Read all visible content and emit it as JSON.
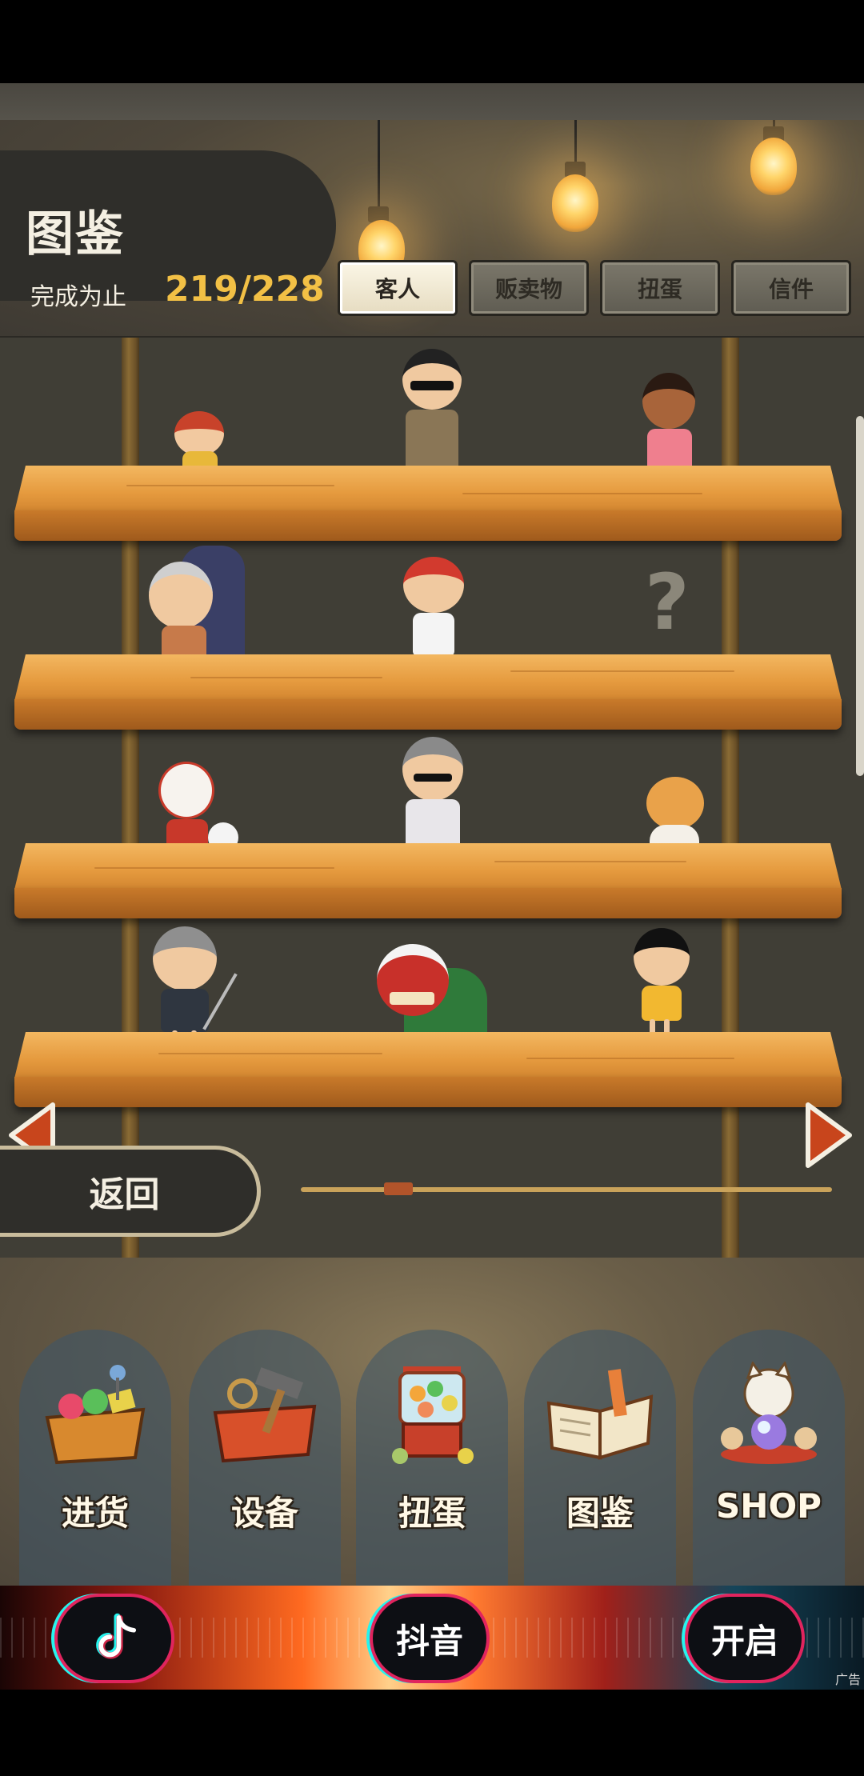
{
  "header": {
    "title": "图鉴",
    "progress_label": "完成为止",
    "progress_value": "219/228"
  },
  "tabs": [
    {
      "label": "客人",
      "active": true
    },
    {
      "label": "贩卖物",
      "active": false
    },
    {
      "label": "扭蛋",
      "active": false
    },
    {
      "label": "信件",
      "active": false
    }
  ],
  "shelf": {
    "unknown_mark": "?",
    "back_label": "返回",
    "scroll_position": 0.13
  },
  "menu": [
    {
      "label": "进货",
      "icon": "basket-goods-icon"
    },
    {
      "label": "设备",
      "icon": "toolbox-icon"
    },
    {
      "label": "扭蛋",
      "icon": "gacha-machine-icon"
    },
    {
      "label": "图鉴",
      "icon": "open-book-icon"
    },
    {
      "label": "SHOP",
      "icon": "lucky-cat-icon"
    }
  ],
  "ad": {
    "buttons": [
      "抖音",
      "开启"
    ],
    "tag": "广告"
  },
  "colors": {
    "accent_gold": "#f2c045",
    "panel_dark": "#2f2e2a",
    "arrow_orange": "#c8451c"
  }
}
